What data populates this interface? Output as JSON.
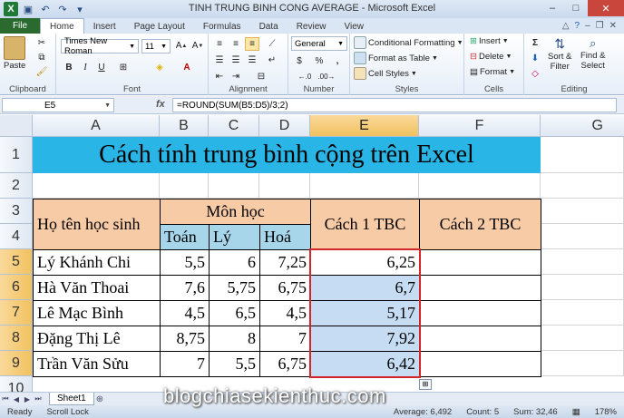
{
  "window": {
    "title": "TINH TRUNG BINH CONG AVERAGE - Microsoft Excel"
  },
  "tabs": [
    "File",
    "Home",
    "Insert",
    "Page Layout",
    "Formulas",
    "Data",
    "Review",
    "View"
  ],
  "ribbon": {
    "clipboard": {
      "label": "Clipboard",
      "paste": "Paste"
    },
    "font": {
      "label": "Font",
      "name": "Times New Roman",
      "size": "11",
      "bold": "B",
      "italic": "I",
      "underline": "U"
    },
    "alignment": {
      "label": "Alignment"
    },
    "number": {
      "label": "Number",
      "format": "General",
      "percent": "%",
      "comma": ",",
      "currency": "$"
    },
    "styles": {
      "label": "Styles",
      "conditional": "Conditional Formatting",
      "format_table": "Format as Table",
      "cell_styles": "Cell Styles"
    },
    "cells": {
      "label": "Cells",
      "insert": "Insert",
      "delete": "Delete",
      "format": "Format"
    },
    "editing": {
      "label": "Editing",
      "sort_filter_1": "Sort &",
      "sort_filter_2": "Filter",
      "find_select_1": "Find &",
      "find_select_2": "Select"
    }
  },
  "formula_bar": {
    "name_box": "E5",
    "fx": "fx",
    "formula": "=ROUND(SUM(B5:D5)/3;2)"
  },
  "columns": [
    "A",
    "B",
    "C",
    "D",
    "E",
    "F",
    "G"
  ],
  "rows": [
    "1",
    "2",
    "3",
    "4",
    "5",
    "6",
    "7",
    "8",
    "9",
    "10"
  ],
  "sheet": {
    "title": "Cách tính trung bình cộng trên Excel",
    "header_name": "Họ tên học sinh",
    "header_subjects": "Môn học",
    "header_toan": "Toán",
    "header_ly": "Lý",
    "header_hoa": "Hoá",
    "header_cach1": "Cách 1 TBC",
    "header_cach2": "Cách 2 TBC",
    "students": [
      {
        "name": "Lý Khánh Chi",
        "toan": "5,5",
        "ly": "6",
        "hoa": "7,25",
        "tbc": "6,25"
      },
      {
        "name": "Hà Văn Thoai",
        "toan": "7,6",
        "ly": "5,75",
        "hoa": "6,75",
        "tbc": "6,7"
      },
      {
        "name": "Lê Mạc Bình",
        "toan": "4,5",
        "ly": "6,5",
        "hoa": "4,5",
        "tbc": "5,17"
      },
      {
        "name": "Đặng Thị Lê",
        "toan": "8,75",
        "ly": "8",
        "hoa": "7",
        "tbc": "7,92"
      },
      {
        "name": "Trần Văn Sửu",
        "toan": "7",
        "ly": "5,5",
        "hoa": "6,75",
        "tbc": "6,42"
      }
    ]
  },
  "sheet_tabs": [
    "Sheet1"
  ],
  "status": {
    "ready": "Ready",
    "scroll_lock": "Scroll Lock",
    "average": "Average: 6,492",
    "count": "Count: 5",
    "sum": "Sum: 32,46",
    "zoom": "178%"
  },
  "watermark": "blogchiasekienthuc.com"
}
